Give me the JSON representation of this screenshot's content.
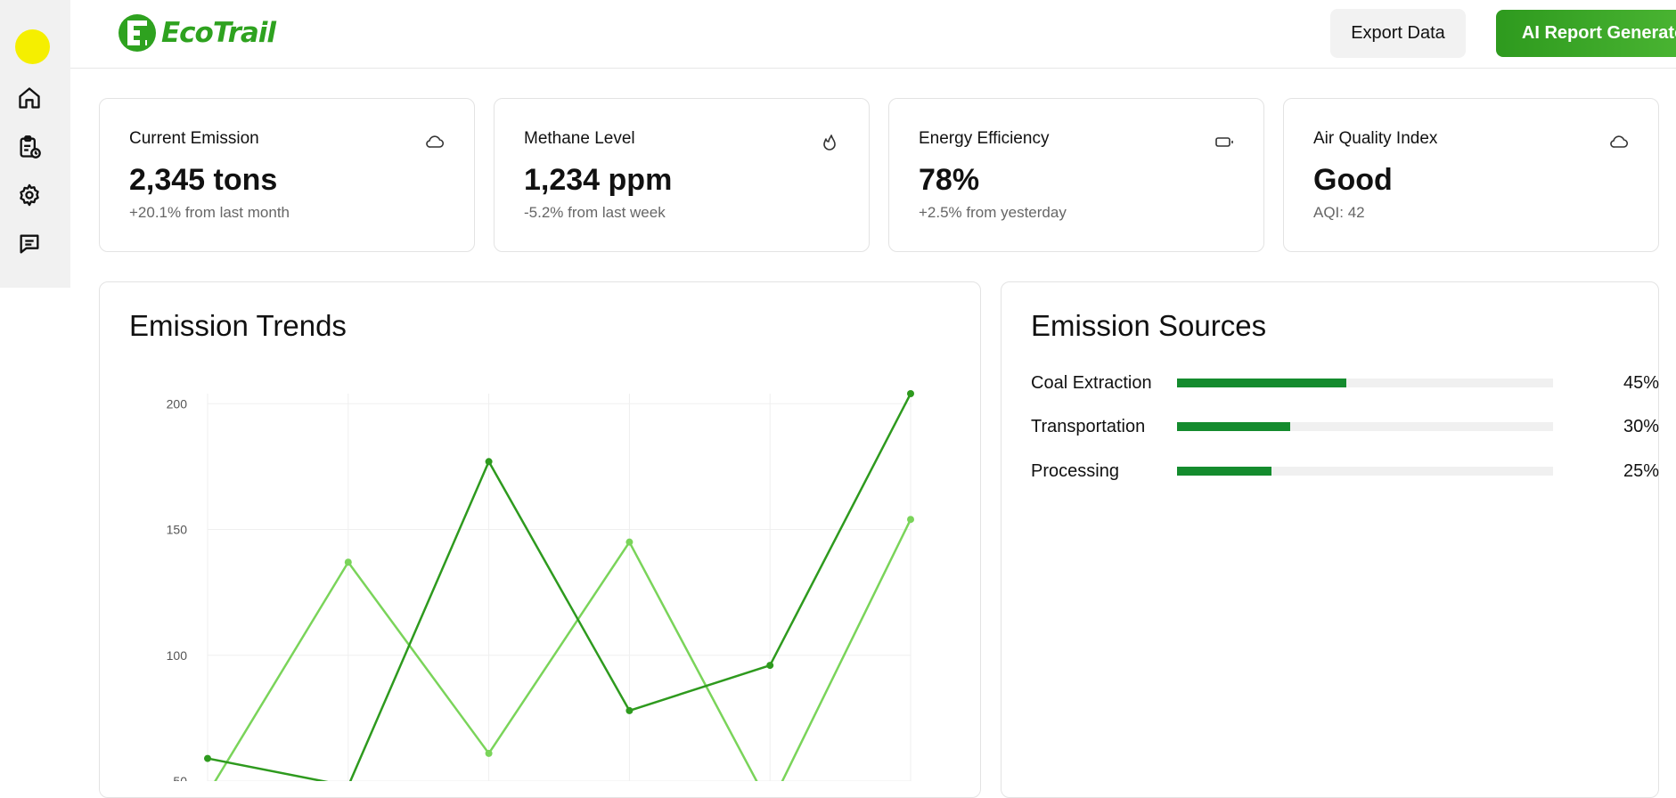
{
  "app": {
    "logo_text": "EcoTrail"
  },
  "sidebar": {
    "items": [
      {
        "icon": "home-icon"
      },
      {
        "icon": "clipboard-clock-icon"
      },
      {
        "icon": "gear-icon"
      },
      {
        "icon": "message-icon"
      }
    ]
  },
  "header": {
    "export_label": "Export Data",
    "ai_label": "AI Report Generator"
  },
  "stats": [
    {
      "title": "Current Emission",
      "value": "2,345 tons",
      "sub": "+20.1% from last month",
      "icon": "cloud-icon"
    },
    {
      "title": "Methane Level",
      "value": "1,234 ppm",
      "sub": "-5.2% from last week",
      "icon": "flame-icon"
    },
    {
      "title": "Energy Efficiency",
      "value": "78%",
      "sub": "+2.5% from yesterday",
      "icon": "battery-icon"
    },
    {
      "title": "Air Quality Index",
      "value": "Good",
      "sub": "AQI: 42",
      "icon": "cloud-icon"
    }
  ],
  "trends": {
    "title": "Emission Trends"
  },
  "sources": {
    "title": "Emission Sources",
    "items": [
      {
        "label": "Coal Extraction",
        "value": 45,
        "pct": "45%"
      },
      {
        "label": "Transportation",
        "value": 30,
        "pct": "30%"
      },
      {
        "label": "Processing",
        "value": 25,
        "pct": "25%"
      }
    ]
  },
  "colors": {
    "accent": "#2e9a1e",
    "series_dark": "#2e9a1e",
    "series_light": "#7ad45a",
    "bar_fill": "#148b2e",
    "indicator": "#f5ef00"
  },
  "chart_data": {
    "type": "line",
    "title": "Emission Trends",
    "xlabel": "",
    "ylabel": "",
    "ylim": [
      50,
      200
    ],
    "yticks": [
      "200",
      "150",
      "100",
      "50"
    ],
    "grid": true,
    "x": [
      0,
      1,
      2,
      3,
      4,
      5
    ],
    "series": [
      {
        "values": [
          59,
          48,
          177,
          78,
          96,
          204
        ],
        "color": "#2e9a1e"
      },
      {
        "values": [
          45,
          137,
          61,
          145,
          40,
          154
        ],
        "color": "#7ad45a"
      }
    ]
  }
}
